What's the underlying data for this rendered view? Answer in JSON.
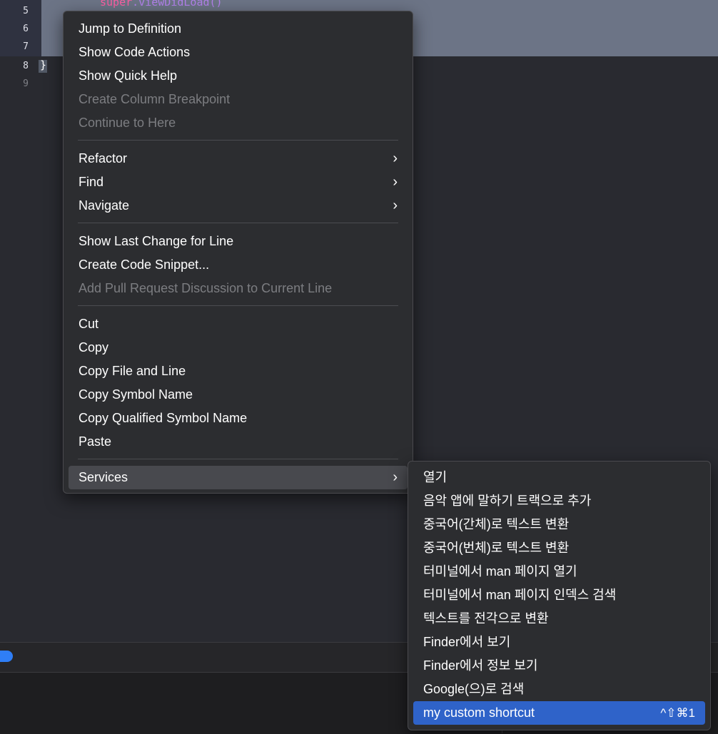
{
  "editor": {
    "line_numbers": [
      "5",
      "6",
      "7",
      "8",
      "9"
    ],
    "code_line_5": "super.viewDidLoad()",
    "code_line_5_keyword": "super",
    "code_line_5_rest": ".viewDidLoad()",
    "code_line_8": "}"
  },
  "context_menu": {
    "group1": [
      {
        "label": "Jump to Definition",
        "enabled": true
      },
      {
        "label": "Show Code Actions",
        "enabled": true
      },
      {
        "label": "Show Quick Help",
        "enabled": true
      },
      {
        "label": "Create Column Breakpoint",
        "enabled": false
      },
      {
        "label": "Continue to Here",
        "enabled": false
      }
    ],
    "group2": [
      {
        "label": "Refactor",
        "submenu": true
      },
      {
        "label": "Find",
        "submenu": true
      },
      {
        "label": "Navigate",
        "submenu": true
      }
    ],
    "group3": [
      {
        "label": "Show Last Change for Line",
        "enabled": true
      },
      {
        "label": "Create Code Snippet...",
        "enabled": true
      },
      {
        "label": "Add Pull Request Discussion to Current Line",
        "enabled": false
      }
    ],
    "group4": [
      {
        "label": "Cut"
      },
      {
        "label": "Copy"
      },
      {
        "label": "Copy File and Line"
      },
      {
        "label": "Copy Symbol Name"
      },
      {
        "label": "Copy Qualified Symbol Name"
      },
      {
        "label": "Paste"
      }
    ],
    "services": {
      "label": "Services",
      "submenu": true
    },
    "arrow_glyph": "›"
  },
  "services_menu": {
    "items": [
      "열기",
      "음악 앱에 말하기 트랙으로 추가",
      "중국어(간체)로 텍스트 변환",
      "중국어(번체)로 텍스트 변환",
      "터미널에서 man 페이지 열기",
      "터미널에서 man 페이지 인덱스 검색",
      "텍스트를 전각으로 변환",
      "Finder에서 보기",
      "Finder에서 정보 보기",
      "Google(으)로 검색"
    ],
    "selected": {
      "label": "my custom shortcut",
      "shortcut": "^⇧⌘1"
    }
  },
  "colors": {
    "menu_bg": "#2c2d30",
    "selection_blue": "#2f63c9",
    "hover_gray": "#48494e",
    "disabled_text": "#7c7d81"
  }
}
